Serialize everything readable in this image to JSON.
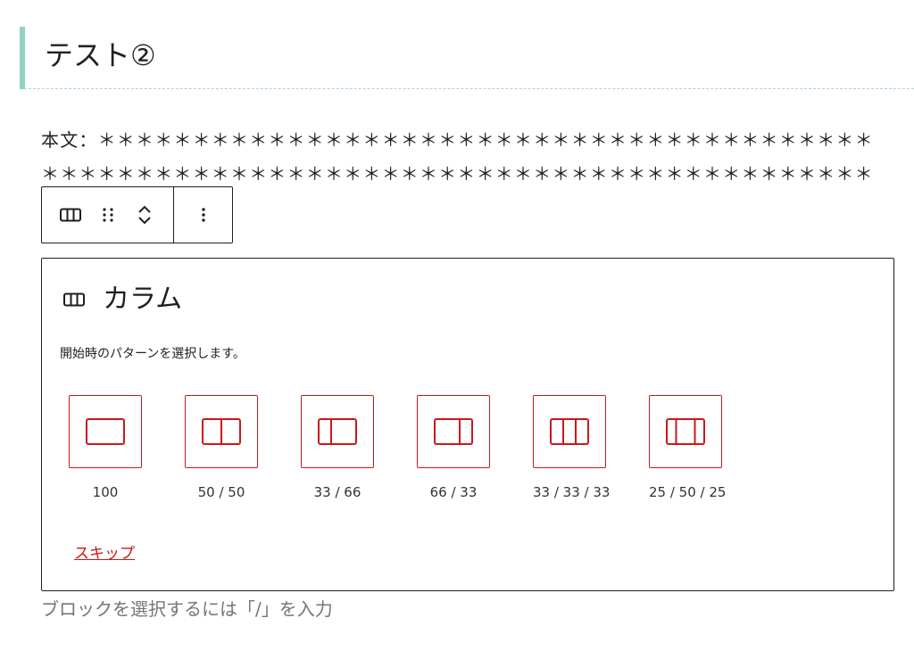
{
  "heading": {
    "text": "テスト②"
  },
  "paragraph": {
    "text": "本文：＊＊＊＊＊＊＊＊＊＊＊＊＊＊＊＊＊＊＊＊＊＊＊＊＊＊＊＊＊＊＊＊＊＊＊＊＊＊＊＊＊＊＊＊＊＊＊＊＊＊＊＊＊＊＊＊＊＊＊＊＊＊＊＊＊＊＊＊＊＊＊＊＊＊＊＊＊＊＊＊＊＊＊＊＊＊＊＊＊＊＊＊＊"
  },
  "toolbar": {
    "icons": [
      "columns-icon",
      "drag-handle-icon",
      "chevron-up-icon",
      "chevron-down-icon",
      "more-vertical-icon"
    ]
  },
  "placeholder": {
    "title": "カラム",
    "instructions": "開始時のパターンを選択します。",
    "variations": [
      {
        "label": "100",
        "cols": [
          100
        ]
      },
      {
        "label": "50 / 50",
        "cols": [
          50,
          50
        ]
      },
      {
        "label": "33 / 66",
        "cols": [
          33,
          66
        ]
      },
      {
        "label": "66 / 33",
        "cols": [
          66,
          33
        ]
      },
      {
        "label": "33 / 33 / 33",
        "cols": [
          33,
          33,
          33
        ]
      },
      {
        "label": "25 / 50 / 25",
        "cols": [
          25,
          50,
          25
        ]
      }
    ],
    "skip_label": "スキップ"
  },
  "appender": {
    "placeholder": "ブロックを選択するには「/」を入力"
  },
  "colors": {
    "accent": "#cc1818",
    "heading_bar": "#8fd2c4",
    "text": "#1e1e1e",
    "muted": "#757575"
  }
}
